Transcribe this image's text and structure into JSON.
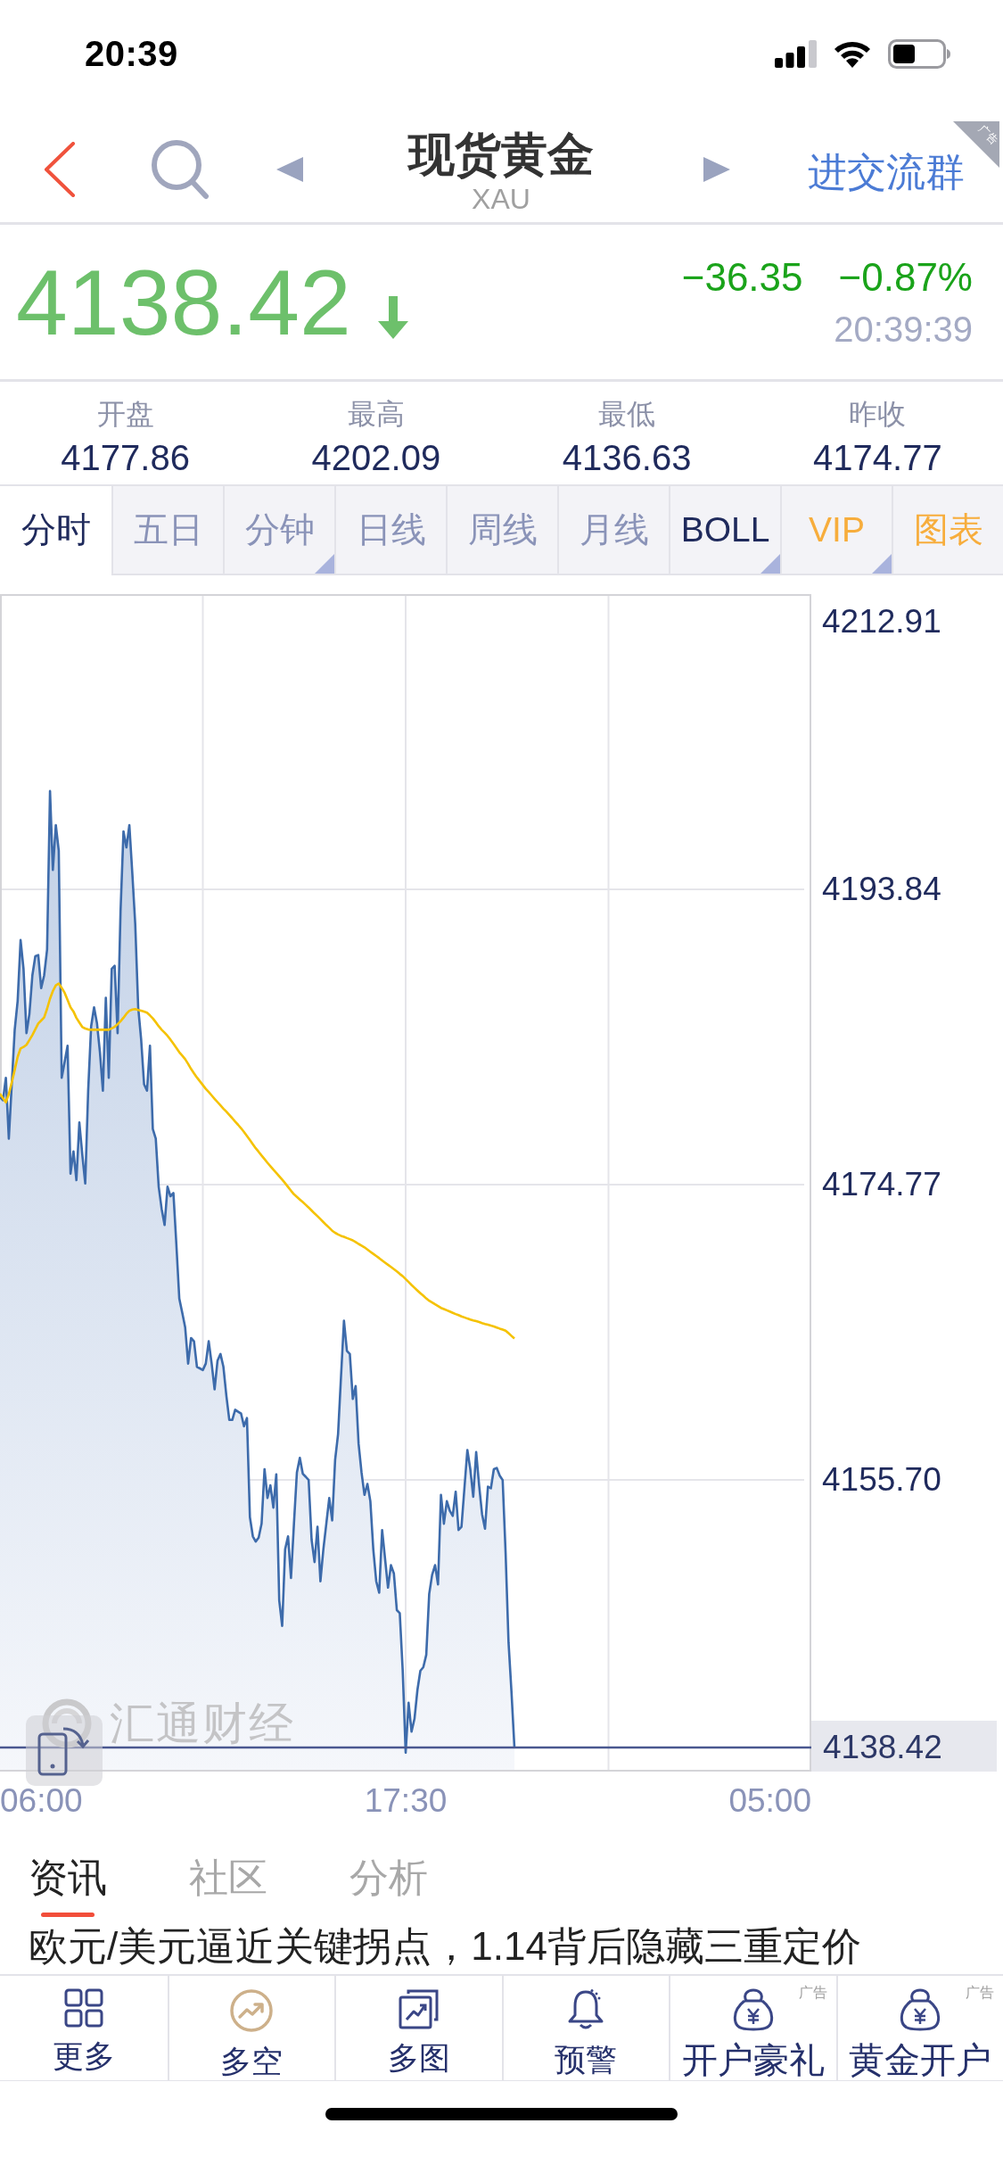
{
  "status_bar": {
    "time": "20:39"
  },
  "nav": {
    "title": "现货黄金",
    "subtitle": "XAU",
    "action": "进交流群",
    "ad_tag": "广告"
  },
  "quote": {
    "price": "4138.42",
    "falling": true,
    "change": "−36.35",
    "change_percent": "−0.87%",
    "time": "20:39:39"
  },
  "stats": [
    {
      "label": "开盘",
      "value": "4177.86"
    },
    {
      "label": "最高",
      "value": "4202.09"
    },
    {
      "label": "最低",
      "value": "4136.63"
    },
    {
      "label": "昨收",
      "value": "4174.77"
    }
  ],
  "period_tabs": [
    {
      "label": "分时",
      "selected": true,
      "kind": "period",
      "dropdown": false
    },
    {
      "label": "五日",
      "selected": false,
      "kind": "period",
      "dropdown": false
    },
    {
      "label": "分钟",
      "selected": false,
      "kind": "period",
      "dropdown": true
    },
    {
      "label": "日线",
      "selected": false,
      "kind": "period",
      "dropdown": false
    },
    {
      "label": "周线",
      "selected": false,
      "kind": "period",
      "dropdown": false
    },
    {
      "label": "月线",
      "selected": false,
      "kind": "period",
      "dropdown": false
    },
    {
      "label": "BOLL",
      "selected": false,
      "kind": "indicator",
      "dropdown": true
    },
    {
      "label": "VIP",
      "selected": false,
      "kind": "premium",
      "dropdown": true
    },
    {
      "label": "图表",
      "selected": false,
      "kind": "premium",
      "dropdown": false
    }
  ],
  "chart": {
    "logo": "汇通财经",
    "time_labels": [
      "06:00",
      "17:30",
      "05:00"
    ],
    "chart_data": {
      "type": "area",
      "grid": true,
      "ylim": [
        4136.86,
        4212.91
      ],
      "categories": [
        null,
        null,
        null,
        null,
        null,
        null,
        null,
        null,
        null,
        null,
        null,
        null,
        null,
        null,
        null,
        null,
        null,
        null,
        null,
        null,
        null,
        null,
        null,
        null,
        null,
        null,
        null,
        null,
        null,
        null,
        null,
        null,
        null,
        null,
        null,
        null,
        null,
        null,
        null,
        null,
        null,
        null,
        null,
        null,
        null,
        null,
        null,
        null,
        null,
        null,
        null,
        null,
        null,
        null,
        null,
        null,
        null,
        null,
        null,
        null,
        null,
        null,
        null,
        null,
        null,
        null,
        null,
        null,
        null,
        null,
        null,
        null,
        null,
        null,
        null,
        null,
        null,
        null,
        null,
        null,
        null,
        null,
        null,
        null,
        null,
        null,
        null,
        null,
        null,
        null,
        null,
        null,
        null,
        null,
        null,
        null,
        null,
        null,
        null,
        null,
        null,
        null,
        null,
        null,
        null,
        null,
        null,
        null,
        null,
        null,
        null,
        null,
        null,
        null,
        null,
        null,
        null,
        null,
        null,
        null,
        null,
        null,
        null,
        null,
        null,
        null,
        null,
        null,
        null,
        null,
        null,
        null,
        null,
        null,
        null,
        null,
        null,
        null,
        null,
        null,
        null,
        null,
        null,
        null,
        null,
        null,
        null,
        null,
        null,
        null,
        null,
        null,
        null,
        null,
        null,
        null,
        null,
        null,
        null,
        null,
        null,
        null,
        null,
        null,
        null,
        null,
        null,
        null,
        null,
        null,
        null,
        null,
        null,
        null,
        null,
        null,
        null,
        null,
        null,
        null,
        null,
        null,
        null,
        null,
        null,
        null,
        null,
        null,
        null,
        null,
        null,
        null,
        null,
        null,
        null,
        null,
        null,
        null,
        null,
        null,
        null,
        null,
        null,
        null,
        null,
        null,
        null,
        null,
        null,
        null,
        null,
        null,
        null,
        null,
        null,
        null,
        null,
        null,
        null,
        null,
        null,
        null,
        null,
        null,
        null,
        null,
        null,
        null,
        null,
        null,
        null,
        null,
        null,
        null,
        null,
        null,
        null,
        null,
        null,
        null,
        null,
        null,
        null,
        null,
        null,
        null,
        null,
        null,
        null,
        null,
        null,
        null,
        null,
        null,
        null,
        null,
        null,
        null,
        null,
        null,
        null,
        null,
        null,
        null,
        null,
        null,
        null,
        null,
        null,
        null,
        null,
        null,
        null,
        null,
        null,
        null,
        null
      ],
      "series": [
        {
          "color": "#3d6bab",
          "values": [
            4180.43,
            4180.22,
            4181.67,
            4177.74,
            4181.25,
            4184.77,
            4186.63,
            4190.56,
            4188.7,
            4184.56,
            4185.8,
            4188.28,
            4189.52,
            4189.6,
            4187.46,
            4188.28,
            4189.94,
            4200.19,
            4195.1,
            4197.99,
            4196.34,
            4181.67,
            4182.7,
            4183.74,
            4175.47,
            4176.92,
            4175.06,
            4178.78,
            4176.71,
            4174.85,
            4180.84,
            4184.98,
            4186.22,
            4185.18,
            4183.32,
            4180.84,
            4186.84,
            4181.67,
            4188.7,
            4188.9,
            4184.56,
            4192.42,
            4197.58,
            4196.55,
            4197.99,
            4194.89,
            4191.59,
            4186.22,
            4184.15,
            4181.25,
            4180.84,
            4183.74,
            4178.36,
            4177.74,
            4174.64,
            4173.2,
            4172.16,
            4174.64,
            4174.02,
            4174.23,
            4170.92,
            4167.41,
            4166.5,
            4165.55,
            4163.21,
            4164.86,
            4164.65,
            4163.0,
            4162.9,
            4162.79,
            4163.21,
            4164.65,
            4163.21,
            4161.55,
            4163.41,
            4163.83,
            4163.0,
            4161.14,
            4159.57,
            4159.57,
            4160.23,
            4160.1,
            4159.98,
            4159.16,
            4159.69,
            4153.29,
            4152.05,
            4151.72,
            4151.97,
            4152.87,
            4156.39,
            4154.53,
            4155.35,
            4153.91,
            4156.06,
            4147.91,
            4146.26,
            4151.22,
            4152.05,
            4149.36,
            4152.87,
            4156.18,
            4157.13,
            4156.1,
            4155.9,
            4155.69,
            4151.84,
            4150.39,
            4152.67,
            4149.15,
            4151.22,
            4152.87,
            4154.53,
            4153.08,
            4157.01,
            4158.66,
            4162.38,
            4165.98,
            4164.03,
            4163.83,
            4160.93,
            4161.76,
            4158.04,
            4156.18,
            4154.73,
            4155.44,
            4154.32,
            4151.22,
            4149.15,
            4148.41,
            4152.46,
            4150.6,
            4148.74,
            4150.19,
            4149.65,
            4147.29,
            4147.09,
            4143.37,
            4138.08,
            4141.3,
            4139.44,
            4140.27,
            4142.13,
            4143.37,
            4143.6,
            4144.4,
            4148.33,
            4149.57,
            4150.19,
            4148.95,
            4154.73,
            4152.87,
            4154.32,
            4153.7,
            4153.37,
            4154.94,
            4152.46,
            4152.67,
            4155.15,
            4157.63,
            4156.39,
            4154.61,
            4157.5,
            4155.35,
            4153.49,
            4152.54,
            4155.27,
            4155.15,
            4156.39,
            4156.47,
            4155.97,
            4155.69,
            4151.0,
            4145.2,
            4142.0,
            4138.42,
            null,
            null,
            null,
            null,
            null,
            null,
            null,
            null,
            null,
            null,
            null,
            null,
            null,
            null,
            null,
            null,
            null,
            null,
            null,
            null,
            null,
            null,
            null,
            null,
            null,
            null,
            null,
            null,
            null,
            null,
            null,
            null,
            null,
            null,
            null,
            null,
            null,
            null,
            null,
            null,
            null,
            null,
            null,
            null,
            null,
            null,
            null,
            null,
            null,
            null,
            null,
            null,
            null,
            null,
            null,
            null,
            null,
            null,
            null,
            null,
            null,
            null,
            null,
            null,
            null,
            null,
            null,
            null,
            null,
            null,
            null,
            null,
            null,
            null,
            null,
            null,
            null,
            null,
            null,
            null,
            null,
            null,
            null,
            null,
            null,
            null,
            null,
            null,
            null,
            null,
            null,
            null,
            null,
            null,
            null,
            null,
            null,
            null,
            null,
            null,
            null
          ]
        },
        {
          "type": "line",
          "color": "#f5c200",
          "values": [
            4180.64,
            4180.36,
            4180.08,
            4180.62,
            4181.37,
            4182.18,
            4183.02,
            4183.57,
            4183.66,
            4183.8,
            4184.11,
            4184.43,
            4184.8,
            4185.18,
            4185.37,
            4185.56,
            4186.12,
            4186.78,
            4187.27,
            4187.64,
            4187.76,
            4187.48,
            4187.16,
            4186.69,
            4186.22,
            4185.95,
            4185.54,
            4185.24,
            4184.95,
            4184.85,
            4184.79,
            4184.77,
            4184.77,
            4184.77,
            4184.77,
            4184.77,
            4184.77,
            4184.77,
            4184.86,
            4184.96,
            4185.13,
            4185.32,
            4185.55,
            4185.81,
            4186.0,
            4186.08,
            4186.11,
            4186.05,
            4186.0,
            4185.94,
            4185.88,
            4185.7,
            4185.51,
            4185.26,
            4185.0,
            4184.78,
            4184.59,
            4184.38,
            4184.14,
            4183.88,
            4183.6,
            4183.32,
            4183.1,
            4182.87,
            4182.57,
            4182.24,
            4181.96,
            4181.69,
            4181.45,
            4181.2,
            4180.96,
            4180.75,
            4180.53,
            4180.31,
            4180.1,
            4179.89,
            4179.68,
            4179.48,
            4179.27,
            4179.06,
            4178.84,
            4178.63,
            4178.41,
            4178.17,
            4177.91,
            4177.65,
            4177.38,
            4177.12,
            4176.89,
            4176.65,
            4176.42,
            4176.18,
            4175.96,
            4175.74,
            4175.53,
            4175.31,
            4175.09,
            4174.86,
            4174.62,
            4174.38,
            4174.15,
            4173.98,
            4173.81,
            4173.64,
            4173.47,
            4173.29,
            4173.1,
            4172.91,
            4172.73,
            4172.54,
            4172.35,
            4172.16,
            4171.98,
            4171.79,
            4171.66,
            4171.55,
            4171.46,
            4171.4,
            4171.32,
            4171.25,
            4171.17,
            4171.06,
            4170.94,
            4170.83,
            4170.72,
            4170.58,
            4170.44,
            4170.3,
            4170.16,
            4170.02,
            4169.87,
            4169.73,
            4169.59,
            4169.45,
            4169.31,
            4169.17,
            4169.0,
            4168.86,
            4168.67,
            4168.48,
            4168.29,
            4168.11,
            4167.93,
            4167.76,
            4167.59,
            4167.42,
            4167.27,
            4167.16,
            4167.04,
            4166.93,
            4166.81,
            4166.73,
            4166.65,
            4166.57,
            4166.49,
            4166.41,
            4166.34,
            4166.26,
            4166.19,
            4166.12,
            4166.06,
            4166.0,
            4165.95,
            4165.89,
            4165.83,
            4165.77,
            4165.72,
            4165.66,
            4165.61,
            4165.54,
            4165.47,
            4165.41,
            4165.34,
            4165.17,
            4165.0,
            4164.83,
            null,
            null,
            null,
            null,
            null,
            null,
            null,
            null,
            null,
            null,
            null,
            null,
            null,
            null,
            null,
            null,
            null,
            null,
            null,
            null,
            null,
            null,
            null,
            null,
            null,
            null,
            null,
            null,
            null,
            null,
            null,
            null,
            null,
            null,
            null,
            null,
            null,
            null,
            null,
            null,
            null,
            null,
            null,
            null,
            null,
            null,
            null,
            null,
            null,
            null,
            null,
            null,
            null,
            null,
            null,
            null,
            null,
            null,
            null,
            null,
            null,
            null,
            null,
            null,
            null,
            null,
            null,
            null,
            null,
            null,
            null,
            null,
            null,
            null,
            null,
            null,
            null,
            null,
            null,
            null,
            null,
            null,
            null,
            null,
            null,
            null,
            null,
            null,
            null,
            null,
            null,
            null,
            null,
            null,
            null,
            null,
            null,
            null,
            null,
            null,
            null
          ]
        }
      ],
      "yticks": [
        {
          "value": 4212.91,
          "label": "4212.91"
        },
        {
          "value": 4193.84,
          "label": "4193.84"
        },
        {
          "value": 4174.77,
          "label": "4174.77"
        },
        {
          "value": 4155.7,
          "label": "4155.70"
        }
      ],
      "ref_lines": [
        {
          "axis": "y",
          "value": 4138.42,
          "label": "4138.42"
        }
      ]
    }
  },
  "news": {
    "tabs": [
      {
        "label": "资讯",
        "selected": true
      },
      {
        "label": "社区",
        "selected": false
      },
      {
        "label": "分析",
        "selected": false
      }
    ],
    "headline": "欧元/美元逼近关键拐点，1.14背后隐藏三重定价"
  },
  "toolbar": [
    {
      "label": "更多",
      "kind": "grid"
    },
    {
      "label": "多空",
      "kind": "trend"
    },
    {
      "label": "多图",
      "kind": "charts"
    },
    {
      "label": "预警",
      "kind": "bell"
    },
    {
      "label": "开户豪礼",
      "kind": "bag",
      "ad_tag": "广告"
    },
    {
      "label": "黄金开户",
      "kind": "bag",
      "ad_tag": "广告"
    }
  ]
}
